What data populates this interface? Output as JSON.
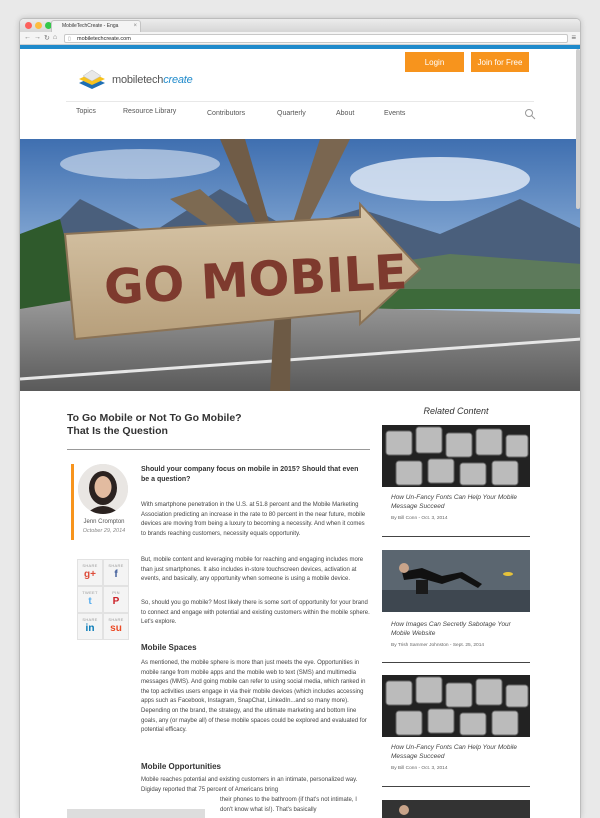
{
  "browser": {
    "tab_title": "MobileTechCreate - Enga",
    "url": "mobiletechcreate.com"
  },
  "header": {
    "logo_plain": "mobiletech",
    "logo_accent": "create",
    "login": "Login",
    "join": "Join for Free"
  },
  "nav": {
    "items": [
      "Topics",
      "Resource Library",
      "Contributors",
      "Quarterly",
      "About",
      "Events"
    ]
  },
  "hero": {
    "sign_text": "GO MOBILE"
  },
  "article": {
    "title_line1": "To Go Mobile or Not To Go Mobile?",
    "title_line2": "That Is the Question",
    "author": "Jenn Crompton",
    "date": "October 29, 2014",
    "lead": "Should your company focus on mobile in 2015? Should that even be a question?",
    "p1": "With smartphone penetration in the U.S. at 51.8 percent and the Mobile Marketing Association predicting an increase in the rate to 80 percent in the near future, mobile devices are moving from being a luxury to becoming a necessity. And when it comes to brands reaching customers, necessity equals opportunity.",
    "p2": "But, mobile content and leveraging mobile for reaching and engaging includes more than just smartphones. It also includes in-store touchscreen devices, activation at events, and basically, any opportunity when someone is using a mobile device.",
    "p3": "So, should you go mobile? Most likely there is some sort of opportunity for your brand to connect and engage with potential and existing customers within the mobile sphere. Let's explore.",
    "h_spaces": "Mobile Spaces",
    "p4": "As mentioned, the mobile sphere is more than just meets the eye. Opportunities in mobile range from mobile apps and the mobile web to text (SMS) and multimedia messages (MMS). And going mobile can refer to using social media, which ranked in the top activities users engage in via their mobile devices (which includes accessing apps such as Facebook, Instagram, SnapChat, LinkedIn...and so many more). Depending on the brand, the strategy, and the ultimate marketing and bottom line goals, any (or maybe all) of these mobile spaces could be explored and evaluated for potential efficacy.",
    "h_opps": "Mobile Opportunities",
    "p5a": "Mobile reaches potential and existing customers in an intimate, personalized way. Digiday reported that 75 percent of Americans bring",
    "p5b": "their phones to the bathroom (if that's not intimate, I don't know what is!). That's basically"
  },
  "share": [
    {
      "caption": "SHARE",
      "icon": "google-plus-icon",
      "glyph": "g+",
      "color": "#dd4b39"
    },
    {
      "caption": "SHARE",
      "icon": "facebook-icon",
      "glyph": "f",
      "color": "#3b5998"
    },
    {
      "caption": "TWEET",
      "icon": "twitter-icon",
      "glyph": "t",
      "color": "#55acee"
    },
    {
      "caption": "PIN",
      "icon": "pinterest-icon",
      "glyph": "P",
      "color": "#cb2027"
    },
    {
      "caption": "SHARE",
      "icon": "linkedin-icon",
      "glyph": "in",
      "color": "#0077b5"
    },
    {
      "caption": "SHARE",
      "icon": "stumbleupon-icon",
      "glyph": "su",
      "color": "#eb4924"
    }
  ],
  "sidebar": {
    "title": "Related Content",
    "items": [
      {
        "title": "How Un-Fancy Fonts Can Help Your Mobile Message Succeed",
        "meta": "By Bill Conn - Oct. 3, 2014"
      },
      {
        "title": "How Images Can Secretly Sabotage Your Mobile Website",
        "meta": "By Trish Sammer Johnston - Sept. 25, 2014"
      },
      {
        "title": "How Un-Fancy Fonts Can Help Your Mobile Message Succeed",
        "meta": "By Bill Conn - Oct. 3, 2014"
      }
    ]
  },
  "colors": {
    "accent": "#f7941d",
    "brand": "#1f8acb"
  }
}
